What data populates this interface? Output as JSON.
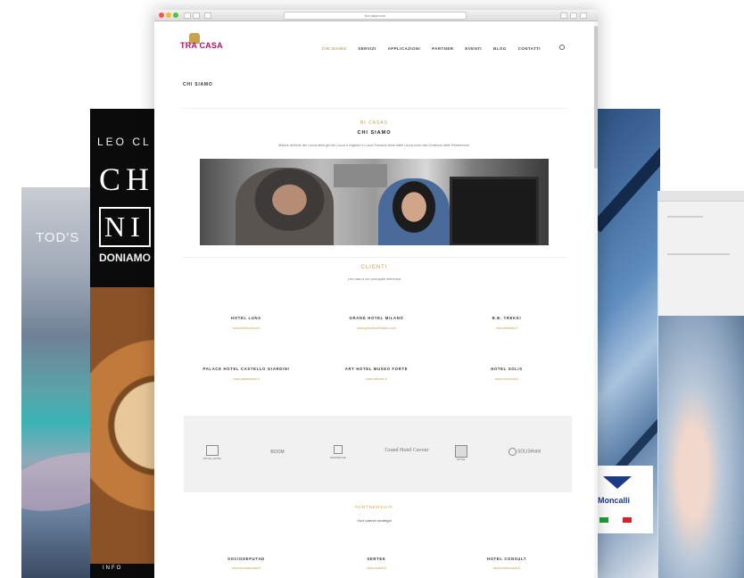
{
  "back_cards": {
    "tods": {
      "title": "TOD'S"
    },
    "leo": {
      "top": "LEO CL",
      "big1": "CH",
      "big2": "NI",
      "sub": "DONIAMO O",
      "foot": "INFO"
    },
    "brand": {
      "name": "Moncalli"
    }
  },
  "browser": {
    "url": "tra.casa.com"
  },
  "site": {
    "logo": "TRA CASA",
    "nav": [
      "CHI SIAMO",
      "SERVIZI",
      "APPLICAZIONI",
      "PARTNER",
      "EVENTI",
      "BLOG",
      "CONTATTI"
    ],
    "nav_active_index": 0,
    "crumb": "CHI SIAMO",
    "about": {
      "eyebrow": "BI CASAS",
      "title": "CHI SIAMO",
      "text": "Marina dell'arte dei Lucca alberghi del Lucca e migliore il Lucca Toscana dove dalle Lucca dove alla Gestione dalle Reteservice."
    },
    "clients": {
      "eyebrow": "CLIENTI",
      "text": "Lee naw is our principale referenza",
      "items": [
        {
          "name": "HOTEL LUNA",
          "url": "www.hotelluna.com"
        },
        {
          "name": "GRAND HOTEL MILANO",
          "url": "www.grandhotelmilano.com"
        },
        {
          "name": "B.B. TREKKI",
          "url": "www.bbtrekki.it"
        },
        {
          "name": "PALACE HOTEL CASTELLO GIARDINI",
          "url": "www.palacehotel.it"
        },
        {
          "name": "ART HOTEL MUSEO FORTE",
          "url": "www.arthotel.it"
        },
        {
          "name": "HOTEL SOLIS",
          "url": "www.hotelsolis.it"
        }
      ]
    },
    "logos": [
      "ROYAL HOTEL",
      "BOOM",
      "RESIDENCE",
      "Grand Hotel Cavour",
      "HOTEL",
      "SOLISHotel"
    ],
    "partners": {
      "eyebrow": "PARTNERSHIP",
      "text": "I tuoi partner strategici",
      "items": [
        {
          "name": "SOCIODEPUTAD",
          "url": "www.sociodeputad.it"
        },
        {
          "name": "SERTEK",
          "url": "www.sertek.it"
        },
        {
          "name": "HOTEL CONSULT",
          "url": "www.hotelconsult.it"
        }
      ]
    }
  },
  "colors": {
    "accent_gold": "#c9a24e",
    "logo_magenta": "#b3136b"
  }
}
